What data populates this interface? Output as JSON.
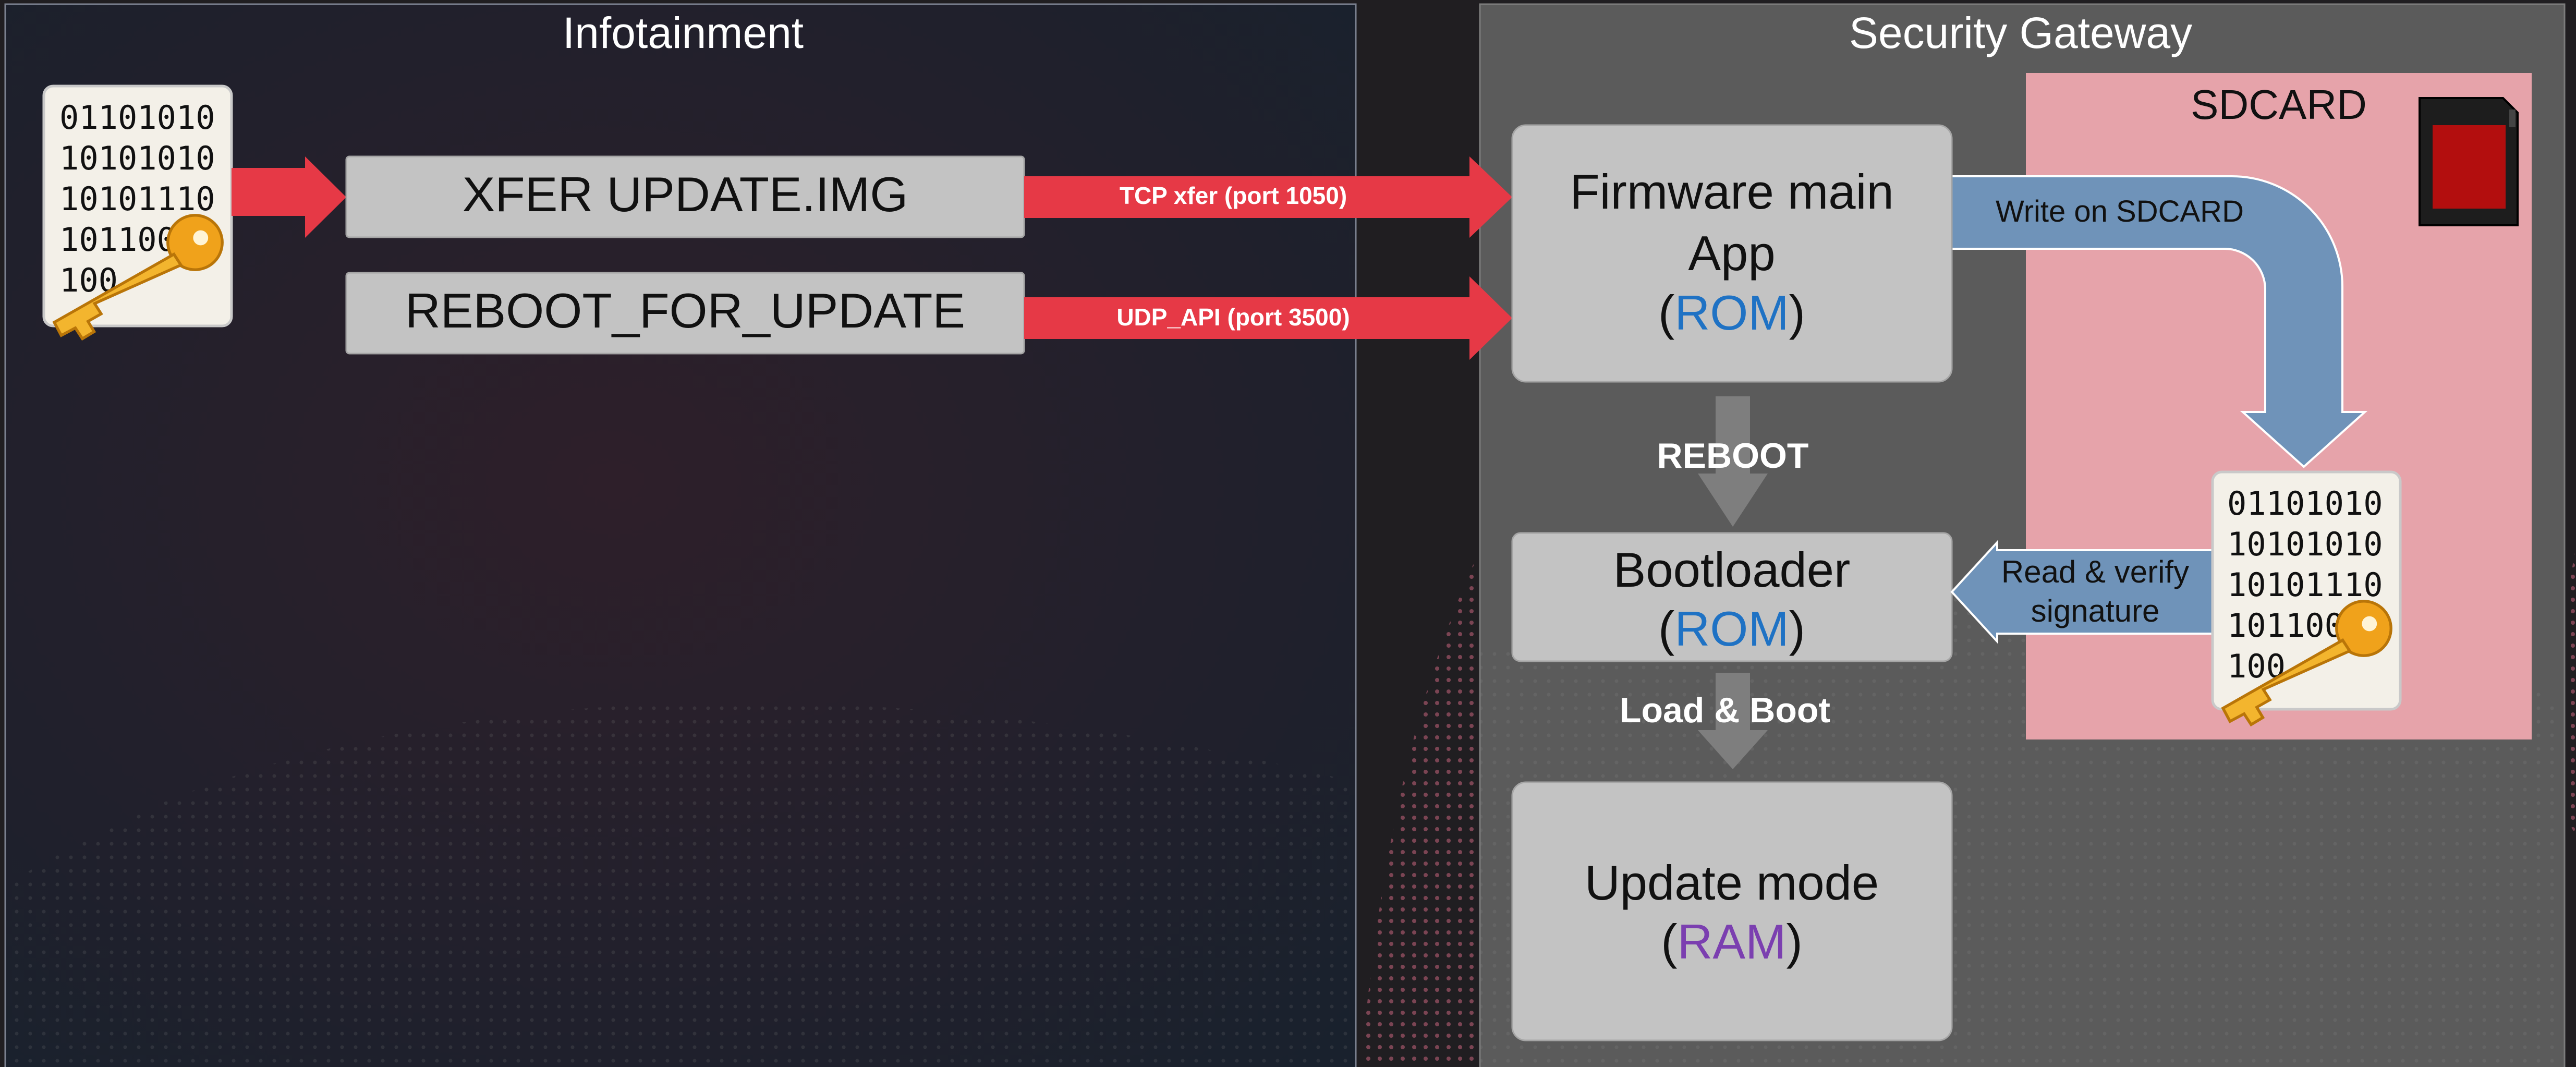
{
  "panels": {
    "infotainment": {
      "title": "Infotainment"
    },
    "gateway": {
      "title": "Security Gateway"
    },
    "sdcard": {
      "title": "SDCARD"
    }
  },
  "commands": {
    "xfer": "XFER UPDATE.IMG",
    "reboot": "REBOOT_FOR_UPDATE"
  },
  "links": {
    "tcp": "TCP xfer (port 1050)",
    "udp": "UDP_API (port 3500)"
  },
  "boxes": {
    "firmware": {
      "line1": "Firmware main",
      "line2": "App",
      "open": "(",
      "mem": "ROM",
      "close": ")"
    },
    "bootloader": {
      "line1": "Bootloader",
      "open": "(",
      "mem": "ROM",
      "close": ")"
    },
    "update": {
      "line1": "Update mode",
      "open": "(",
      "mem": "RAM",
      "close": ")"
    }
  },
  "flow": {
    "reboot": "REBOOT",
    "load": "Load & Boot",
    "write": "Write on SDCARD",
    "read_line1": "Read & verify",
    "read_line2": "signature"
  },
  "image_file": {
    "lines": [
      "01101010",
      "10101010",
      "10101110",
      "1011001",
      "100"
    ]
  },
  "colors": {
    "red_arrow": "#e63946",
    "blue_arrow": "#6f93b9",
    "rom": "#1f72c4",
    "ram": "#7b3fb0",
    "sdcard_bg": "#e6a3aa",
    "gateway_bg": "#5a5a5a",
    "box_bg": "#c3c3c3"
  }
}
